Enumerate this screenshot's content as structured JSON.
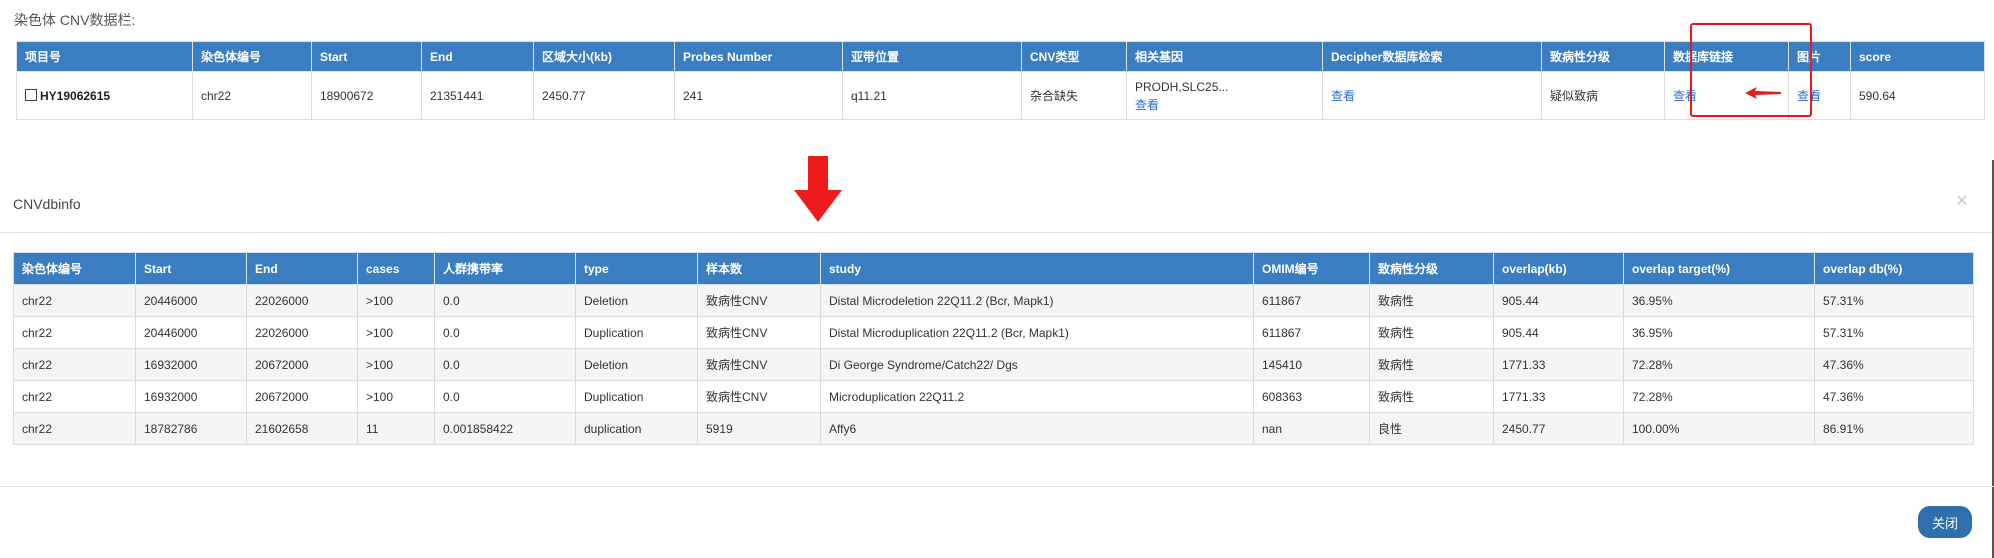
{
  "section_title": "染色体 CNV数据栏:",
  "top_table": {
    "headers": [
      "项目号",
      "染色体编号",
      "Start",
      "End",
      "区域大小(kb)",
      "Probes Number",
      "亚带位置",
      "CNV类型",
      "相关基因",
      "Decipher数据库检索",
      "致病性分级",
      "数据库链接",
      "图片",
      "score"
    ],
    "row": {
      "project": "HY19062615",
      "chrom": "chr22",
      "start": "18900672",
      "end": "21351441",
      "size": "2450.77",
      "probes": "241",
      "band": "q11.21",
      "cnv_type": "杂合缺失",
      "genes": "PRODH,SLC25...",
      "genes_link": "查看",
      "decipher_link": "查看",
      "pathogenicity": "疑似致病",
      "db_link": "查看",
      "image_link": "查看",
      "score": "590.64"
    }
  },
  "annotation_color": "#e81a1a",
  "modal": {
    "title": "CNVdbinfo",
    "close_icon": "×",
    "close_button": "关闭",
    "headers": [
      "染色体编号",
      "Start",
      "End",
      "cases",
      "人群携带率",
      "type",
      "样本数",
      "study",
      "OMIM编号",
      "致病性分级",
      "overlap(kb)",
      "overlap target(%)",
      "overlap db(%)"
    ],
    "rows": [
      [
        "chr22",
        "20446000",
        "22026000",
        ">100",
        "0.0",
        "Deletion",
        "致病性CNV",
        "Distal Microdeletion 22Q11.2 (Bcr, Mapk1)",
        "611867",
        "致病性",
        "905.44",
        "36.95%",
        "57.31%"
      ],
      [
        "chr22",
        "20446000",
        "22026000",
        ">100",
        "0.0",
        "Duplication",
        "致病性CNV",
        "Distal Microduplication 22Q11.2 (Bcr, Mapk1)",
        "611867",
        "致病性",
        "905.44",
        "36.95%",
        "57.31%"
      ],
      [
        "chr22",
        "16932000",
        "20672000",
        ">100",
        "0.0",
        "Deletion",
        "致病性CNV",
        "Di George Syndrome/Catch22/ Dgs",
        "145410",
        "致病性",
        "1771.33",
        "72.28%",
        "47.36%"
      ],
      [
        "chr22",
        "16932000",
        "20672000",
        ">100",
        "0.0",
        "Duplication",
        "致病性CNV",
        "Microduplication 22Q11.2",
        "608363",
        "致病性",
        "1771.33",
        "72.28%",
        "47.36%"
      ],
      [
        "chr22",
        "18782786",
        "21602658",
        "11",
        "0.001858422",
        "duplication",
        "5919",
        "Affy6",
        "nan",
        "良性",
        "2450.77",
        "100.00%",
        "86.91%"
      ]
    ]
  },
  "colors": {
    "header_bg": "#3a7dc0",
    "link": "#2a6fc9",
    "button_bg": "#2e6fad"
  }
}
